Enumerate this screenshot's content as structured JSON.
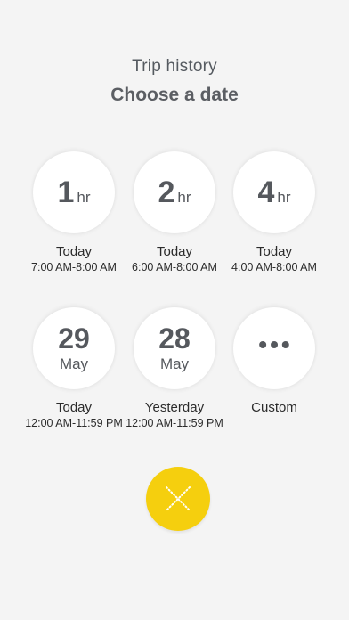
{
  "header": {
    "subtitle": "Trip history",
    "title": "Choose a date"
  },
  "options": [
    {
      "value": "1",
      "unit": "hr",
      "label": "Today",
      "range": "7:00 AM-8:00 AM"
    },
    {
      "value": "2",
      "unit": "hr",
      "label": "Today",
      "range": "6:00 AM-8:00 AM"
    },
    {
      "value": "4",
      "unit": "hr",
      "label": "Today",
      "range": "4:00 AM-8:00 AM"
    },
    {
      "day": "29",
      "month": "May",
      "label": "Today",
      "range": "12:00 AM-11:59 PM"
    },
    {
      "day": "28",
      "month": "May",
      "label": "Yesterday",
      "range": "12:00 AM-11:59 PM"
    },
    {
      "symbol": "•••",
      "label": "Custom"
    }
  ],
  "close_icon": "close-x-icon",
  "colors": {
    "accent": "#f5cf0e",
    "background": "#f4f4f4",
    "text": "#55585d"
  }
}
